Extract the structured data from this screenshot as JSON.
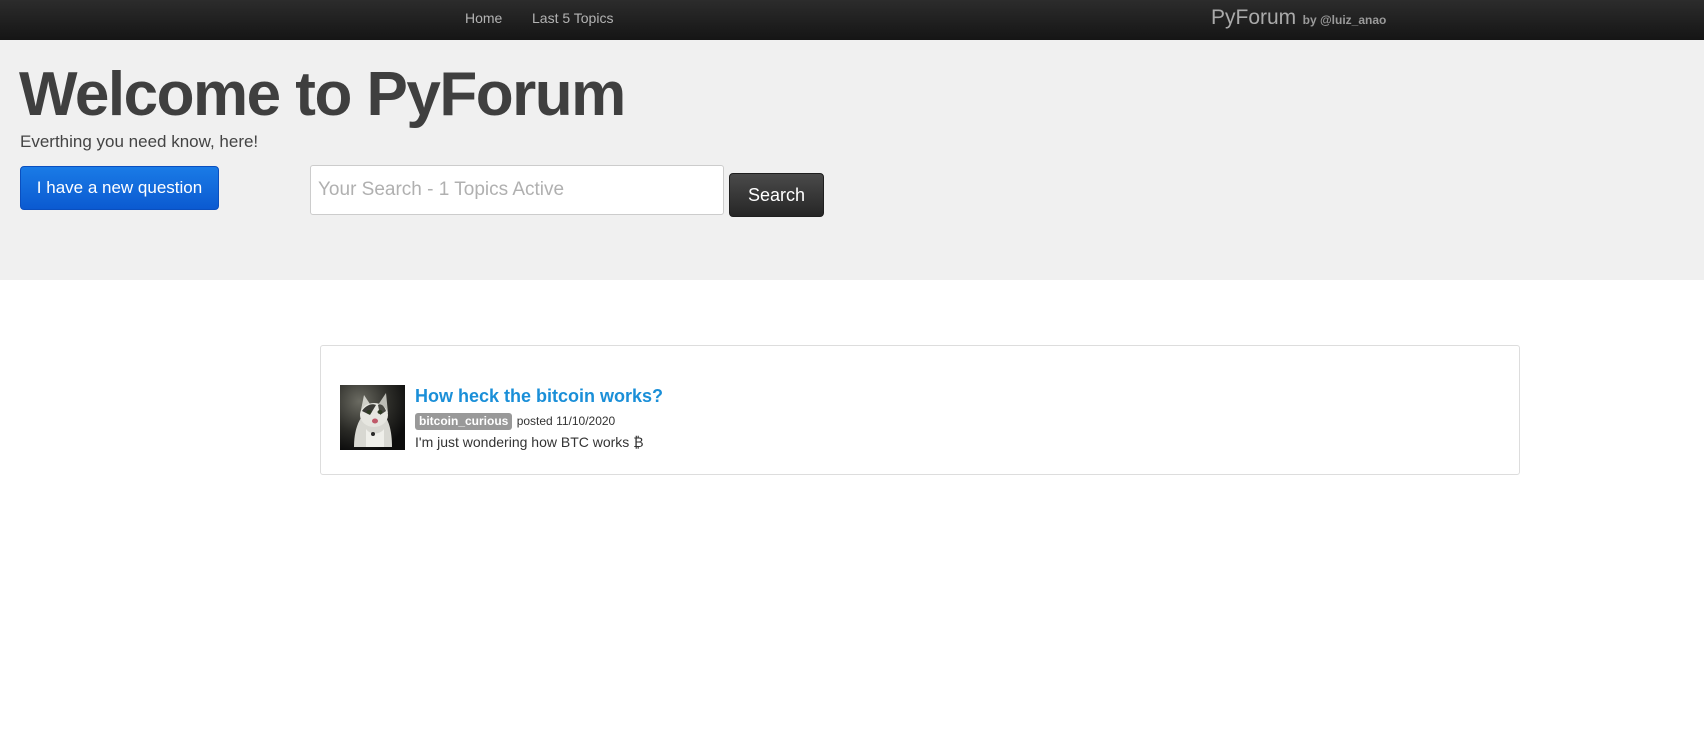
{
  "navbar": {
    "links": [
      {
        "label": "Home"
      },
      {
        "label": "Last 5 Topics"
      }
    ],
    "brand": {
      "name": "PyForum",
      "byline": "by @luiz_anao"
    }
  },
  "hero": {
    "title": "Welcome to PyForum",
    "subtitle": "Everthing you need know, here!",
    "new_question_label": "I have a new question",
    "search": {
      "placeholder": "Your Search - 1 Topics Active",
      "value": "",
      "button_label": "Search"
    }
  },
  "topics": [
    {
      "title": "How heck the bitcoin works?",
      "author": "bitcoin_curious",
      "posted_prefix": "posted",
      "date": "11/10/2020",
      "excerpt": "I'm just wondering how BTC works ₿",
      "avatar_icon": "cat-photo"
    }
  ],
  "colors": {
    "link": "#1a8fd8",
    "primary_button": "#0b5ad1",
    "navbar": "#1b1b1b",
    "hero_bg": "#f0f0f0"
  }
}
